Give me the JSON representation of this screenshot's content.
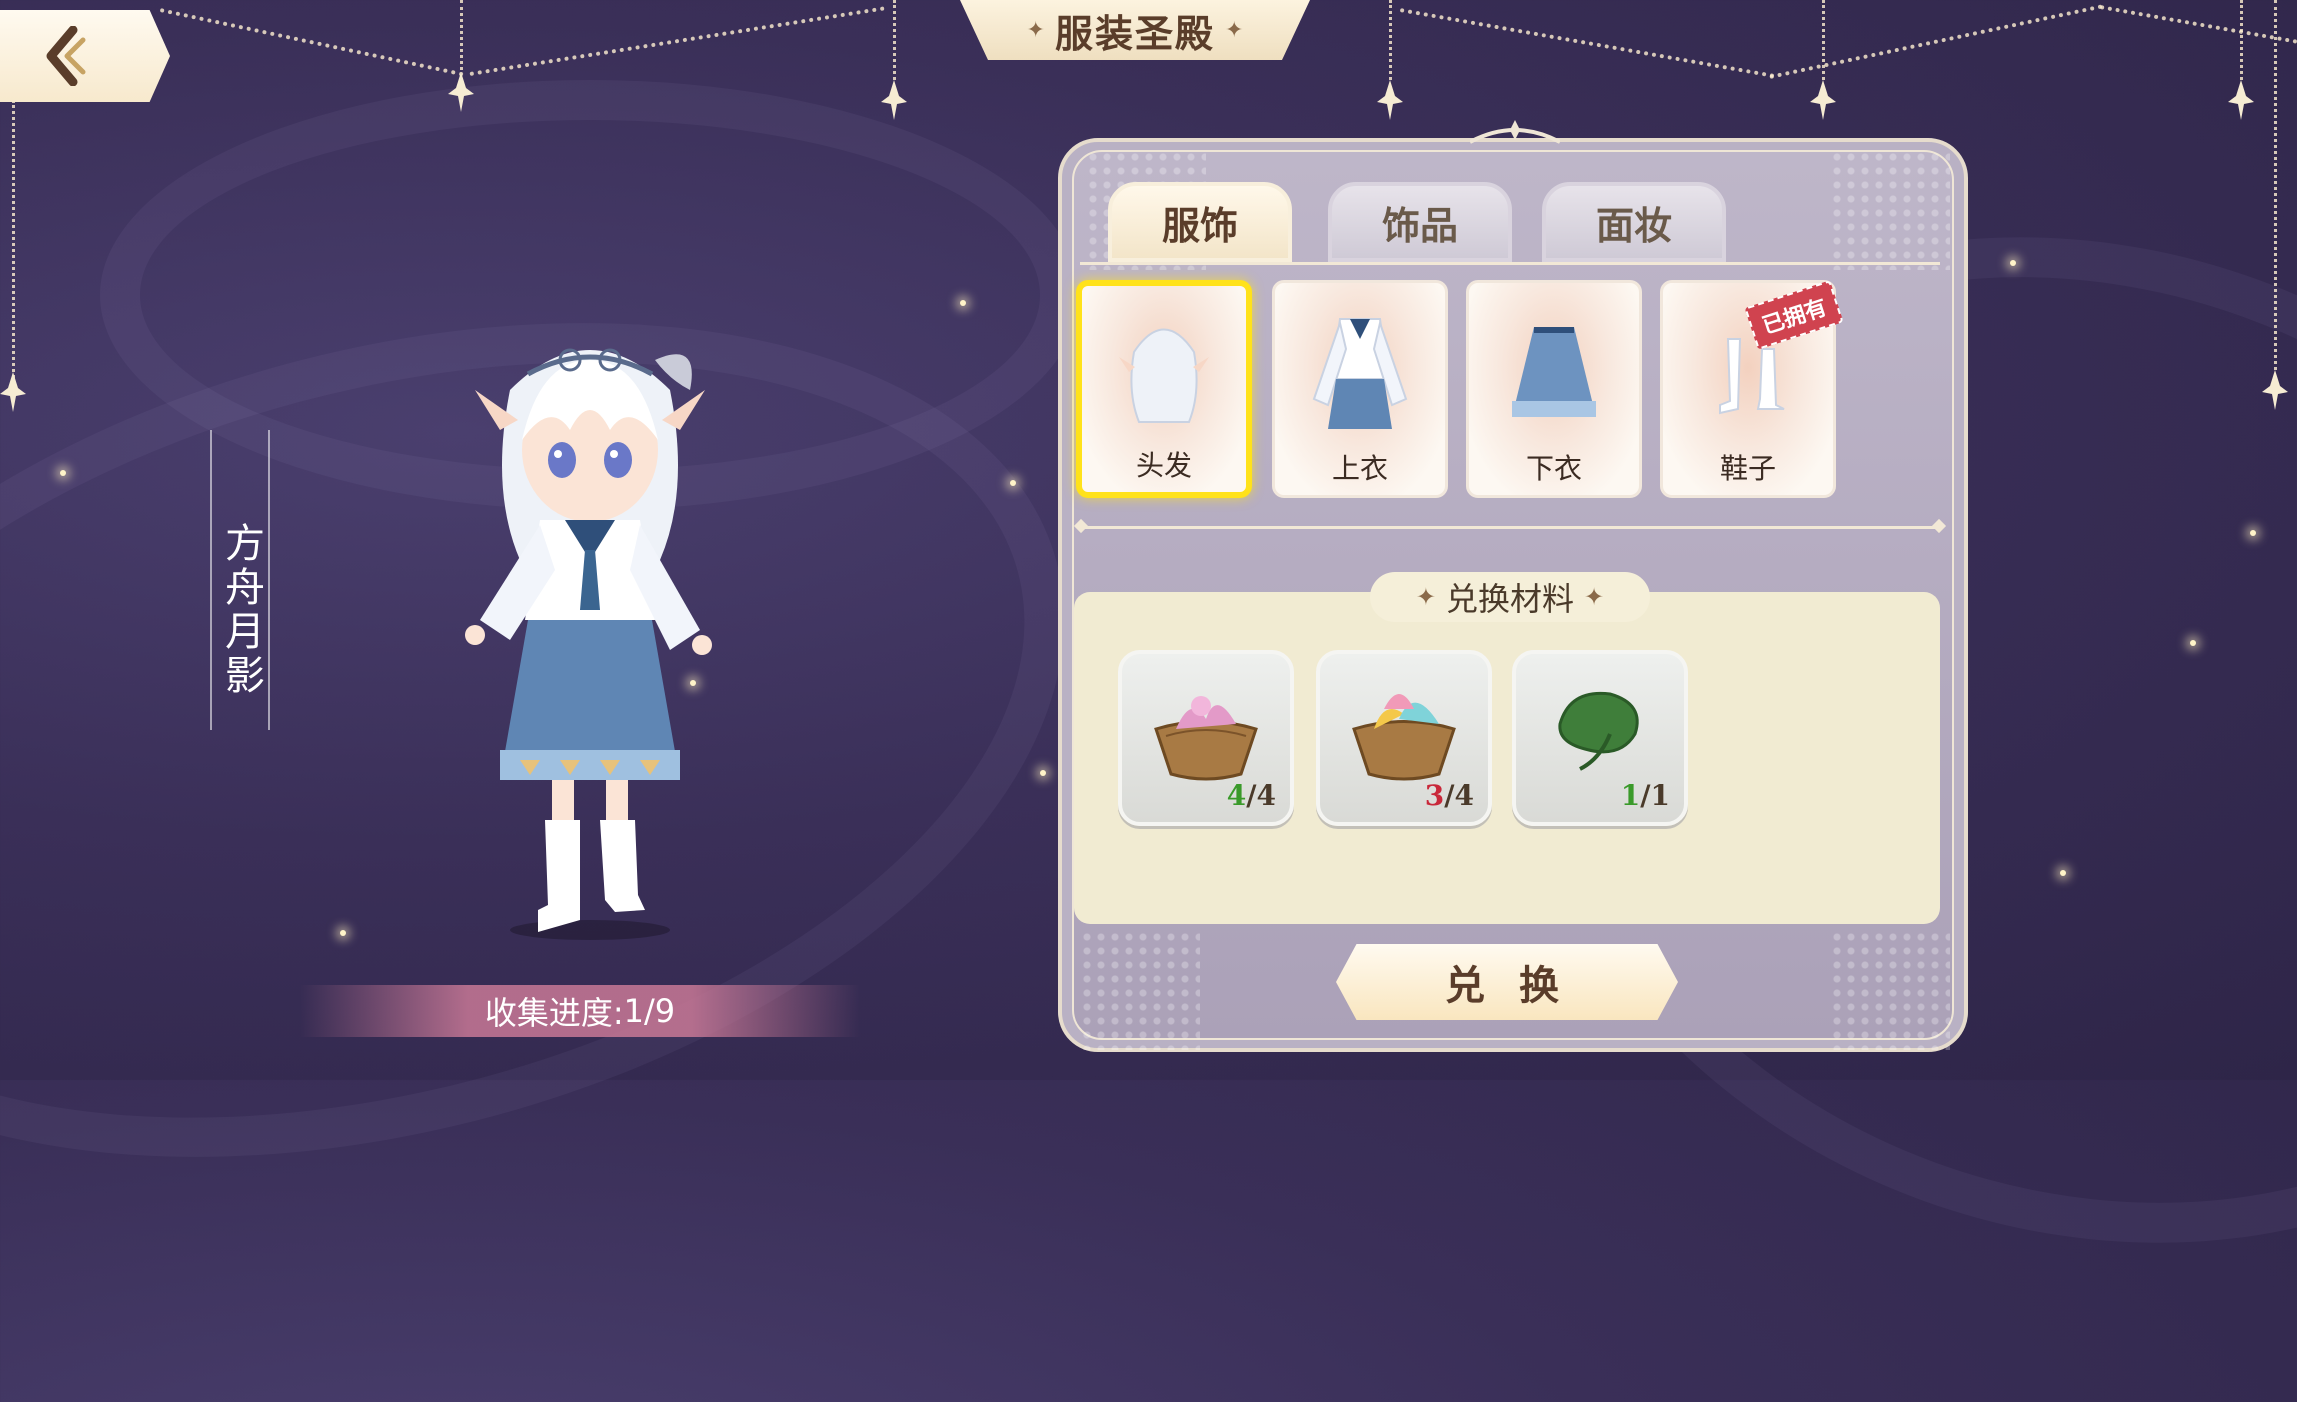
{
  "header": {
    "title": "服装圣殿",
    "back_icon": "chevron-left-icon"
  },
  "character": {
    "name": "方舟月影",
    "progress_label": "收集进度:",
    "progress_value": "1/9"
  },
  "tabs": [
    {
      "label": "服饰",
      "active": true
    },
    {
      "label": "饰品",
      "active": false
    },
    {
      "label": "面妆",
      "active": false
    }
  ],
  "items": [
    {
      "label": "头发",
      "icon": "hair-icon",
      "selected": true,
      "owned": false
    },
    {
      "label": "上衣",
      "icon": "top-icon",
      "selected": false,
      "owned": false
    },
    {
      "label": "下衣",
      "icon": "skirt-icon",
      "selected": false,
      "owned": false
    },
    {
      "label": "鞋子",
      "icon": "shoes-icon",
      "selected": false,
      "owned": true
    }
  ],
  "owned_stamp": "已拥有",
  "materials": {
    "title": "兑换材料",
    "list": [
      {
        "icon": "pink-flower-basket-icon",
        "have": "4",
        "need": "4",
        "enough": true
      },
      {
        "icon": "rainbow-petal-basket-icon",
        "have": "3",
        "need": "4",
        "enough": false
      },
      {
        "icon": "green-leaf-icon",
        "have": "1",
        "need": "1",
        "enough": true
      }
    ]
  },
  "exchange_button": "兑 换",
  "colors": {
    "background": "#3a2f58",
    "panel": "#b9b1c4",
    "selected_border": "#ffe21a",
    "count_ok": "#3a9a2a",
    "count_lack": "#c9283a"
  }
}
